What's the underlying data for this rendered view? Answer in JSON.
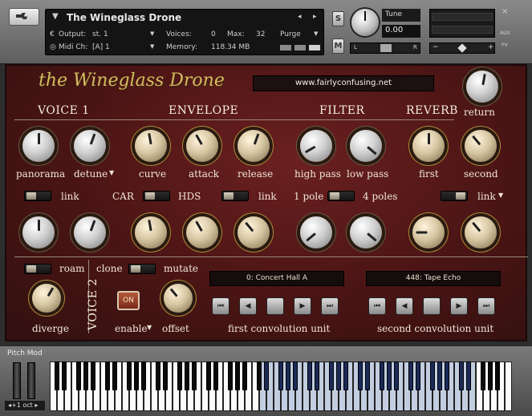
{
  "header": {
    "instrument_name": "The Wineglass Drone",
    "output_label": "Output:",
    "output_value": "st. 1",
    "voices_label": "Voices:",
    "voices_value": "0",
    "max_label": "Max:",
    "max_value": "32",
    "purge_label": "Purge",
    "midi_label": "Midi Ch:",
    "midi_value": "[A]  1",
    "memory_label": "Memory:",
    "memory_value": "118.34 MB",
    "solo_label": "S",
    "mute_label": "M",
    "tune_label": "Tune",
    "tune_value": "0.00",
    "pan_left": "L",
    "pan_right": "R",
    "aux_label": "AUX",
    "pv_label": "PV",
    "close_label": "×"
  },
  "panel": {
    "logo_text": "the Wineglass Drone",
    "url": "www.fairlyconfusing.net",
    "return_label": "return",
    "sections": {
      "voice1": "VOICE 1",
      "envelope": "ENVELOPE",
      "filter": "FILTER",
      "reverb": "REVERB",
      "voice2": "VOICE 2"
    },
    "knob_labels": {
      "panorama": "panorama",
      "detune": "detune",
      "curve": "curve",
      "attack": "attack",
      "release": "release",
      "high_pass": "high pass",
      "low_pass": "low pass",
      "first": "first",
      "second": "second"
    },
    "toggles": {
      "link1": "link",
      "car": "CAR",
      "hds": "HDS",
      "link2": "link",
      "one_pole": "1 pole",
      "four_poles": "4 poles",
      "link3": "link",
      "roam": "roam",
      "clone": "clone",
      "mutate": "mutate"
    },
    "diverge_label": "diverge",
    "enable_label": "enable",
    "offset_label": "offset",
    "on_label": "ON",
    "conv1_preset": "0: Concert Hall A",
    "conv2_preset": "448: Tape Echo",
    "conv1_label": "first convolution unit",
    "conv2_label": "second convolution unit"
  },
  "keyboard": {
    "pitch_mod_label": "Pitch Mod",
    "octave_label": "+1 oct",
    "selected_range_start_key": 29,
    "selected_range_end_key": 58,
    "white_key_count": 64
  }
}
